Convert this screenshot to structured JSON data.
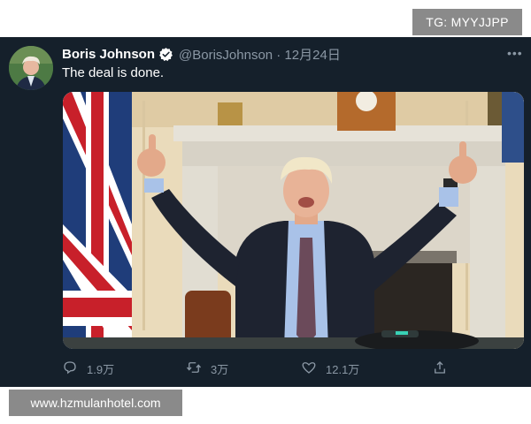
{
  "watermarks": {
    "top": "TG: MYYJJPP",
    "bottom": "www.hzmulanhotel.com"
  },
  "tweet": {
    "author_name": "Boris Johnson",
    "handle_line": "@BorisJohnson · 12月24日",
    "text": "The deal is done.",
    "more_label": "•••",
    "avatar_icon": "profile-photo",
    "verified_icon": "verified-badge",
    "media_description_icon": "tweet-photo",
    "actions": {
      "reply_count": "1.9万",
      "retweet_count": "3万",
      "like_count": "12.1万"
    }
  },
  "colors": {
    "background": "#15202b",
    "verified": "#ffffff",
    "muted": "#8b98a5"
  }
}
